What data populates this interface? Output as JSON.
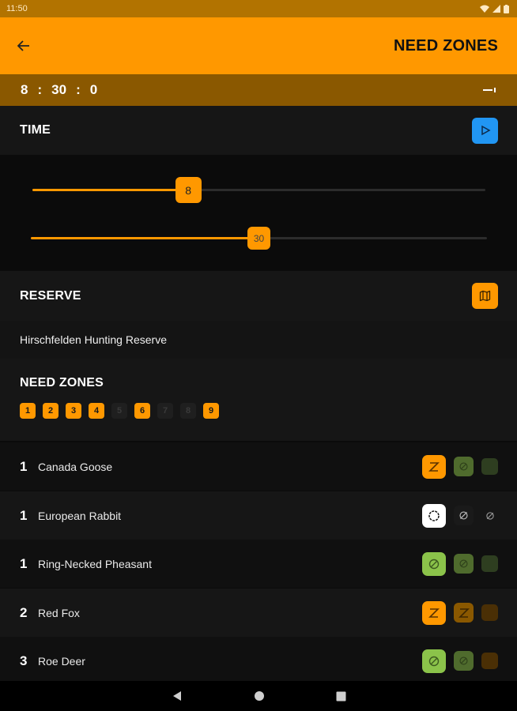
{
  "status_bar": {
    "time": "11:50"
  },
  "app_bar": {
    "title": "NEED ZONES"
  },
  "clock": {
    "hour": "8",
    "minute": "30",
    "second": "0",
    "separator": ":"
  },
  "time_section": {
    "title": "TIME",
    "hour_value": "8",
    "minute_value": "30",
    "hour_fraction": 0.344,
    "minute_fraction": 0.5
  },
  "reserve_section": {
    "title": "RESERVE",
    "value": "Hirschfelden Hunting Reserve"
  },
  "zones_section": {
    "title": "NEED ZONES",
    "levels": [
      {
        "label": "1",
        "active": true
      },
      {
        "label": "2",
        "active": true
      },
      {
        "label": "3",
        "active": true
      },
      {
        "label": "4",
        "active": true
      },
      {
        "label": "5",
        "active": false
      },
      {
        "label": "6",
        "active": true
      },
      {
        "label": "7",
        "active": false
      },
      {
        "label": "8",
        "active": false
      },
      {
        "label": "9",
        "active": true
      }
    ]
  },
  "animals": [
    {
      "level": "1",
      "name": "Canada Goose",
      "zones": [
        "zone-z-active",
        "zone-feed-dim",
        "zone-empty-dim"
      ]
    },
    {
      "level": "1",
      "name": "European Rabbit",
      "zones": [
        "zone-ring-white",
        "zone-none-dark",
        "zone-none-plain"
      ]
    },
    {
      "level": "1",
      "name": "Ring-Necked Pheasant",
      "zones": [
        "zone-feed-active",
        "zone-feed-dim",
        "zone-empty-dim"
      ]
    },
    {
      "level": "2",
      "name": "Red Fox",
      "zones": [
        "zone-z-active",
        "zone-z-dim",
        "zone-empty-brown"
      ]
    },
    {
      "level": "3",
      "name": "Roe Deer",
      "zones": [
        "zone-feed-active",
        "zone-feed-dim",
        "zone-empty-brown"
      ]
    }
  ],
  "colors": {
    "accent": "#ff9800",
    "play_button": "#2196f3",
    "feed_green": "#8bc34a",
    "rest_brown": "#b27300"
  }
}
